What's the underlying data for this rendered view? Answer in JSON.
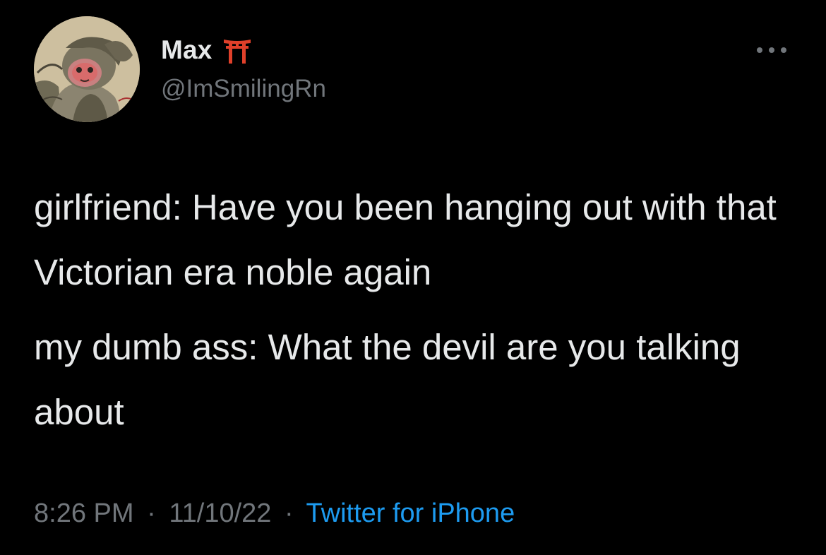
{
  "author": {
    "display_name": "Max",
    "handle": "@ImSmilingRn",
    "name_emoji_icon": "torii-gate-icon",
    "avatar_icon": "monkey-avatar"
  },
  "tweet": {
    "paragraphs": [
      "girlfriend: Have you been hanging out with that Victorian era noble again",
      "my dumb ass: What the devil are you talking about"
    ]
  },
  "meta": {
    "time": "8:26 PM",
    "separator": "·",
    "date": "11/10/22",
    "source": "Twitter for iPhone"
  },
  "colors": {
    "background": "#000000",
    "text_primary": "#e7e9ea",
    "text_secondary": "#71767b",
    "link": "#1d9bf0",
    "torii": "#e0402a"
  }
}
